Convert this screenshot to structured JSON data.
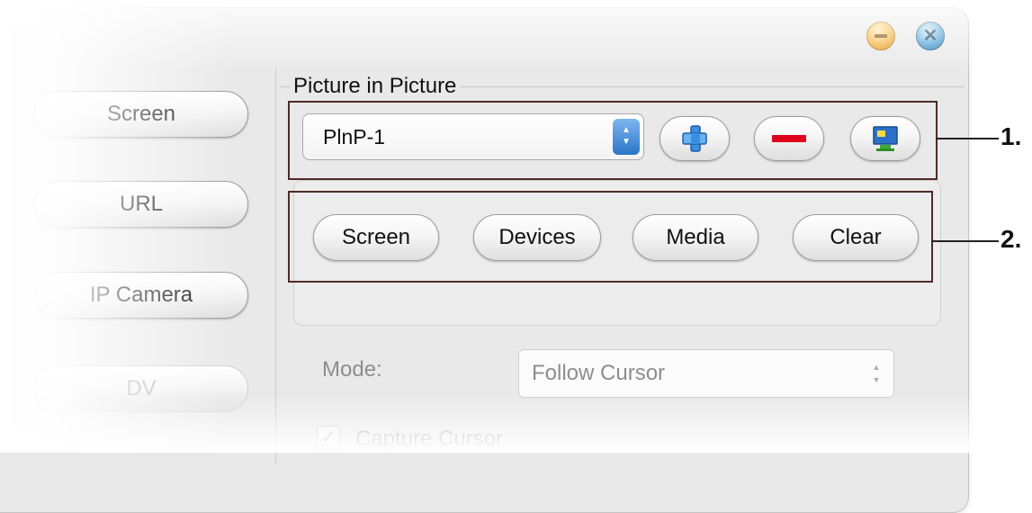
{
  "window": {
    "minimize_icon": "minimize-icon",
    "close_icon": "close-icon",
    "close_glyph": "✕"
  },
  "sidebar": {
    "items": [
      {
        "label": "Screen",
        "enabled": true
      },
      {
        "label": "URL",
        "enabled": true
      },
      {
        "label": "IP Camera",
        "enabled": true
      },
      {
        "label": "DV",
        "enabled": false
      }
    ]
  },
  "pip": {
    "group_title": "Picture in Picture",
    "selected": "PlnP-1",
    "actions": [
      {
        "name": "add-pip-button",
        "icon": "add-pip-icon"
      },
      {
        "name": "remove-pip-button",
        "icon": "minus-icon"
      },
      {
        "name": "display-pip-button",
        "icon": "monitor-icon"
      }
    ],
    "sources": [
      "Screen",
      "Devices",
      "Media",
      "Clear"
    ]
  },
  "settings": {
    "mode_label": "Mode:",
    "mode_value": "Follow Cursor",
    "capture_cursor_label": "Capture Cursor",
    "capture_cursor_checked": true
  },
  "callouts": [
    "1.",
    "2."
  ],
  "colors": {
    "highlight_border": "#4f2a25",
    "minus_red": "#e0001b",
    "icon_blue": "#3a8ee0"
  }
}
